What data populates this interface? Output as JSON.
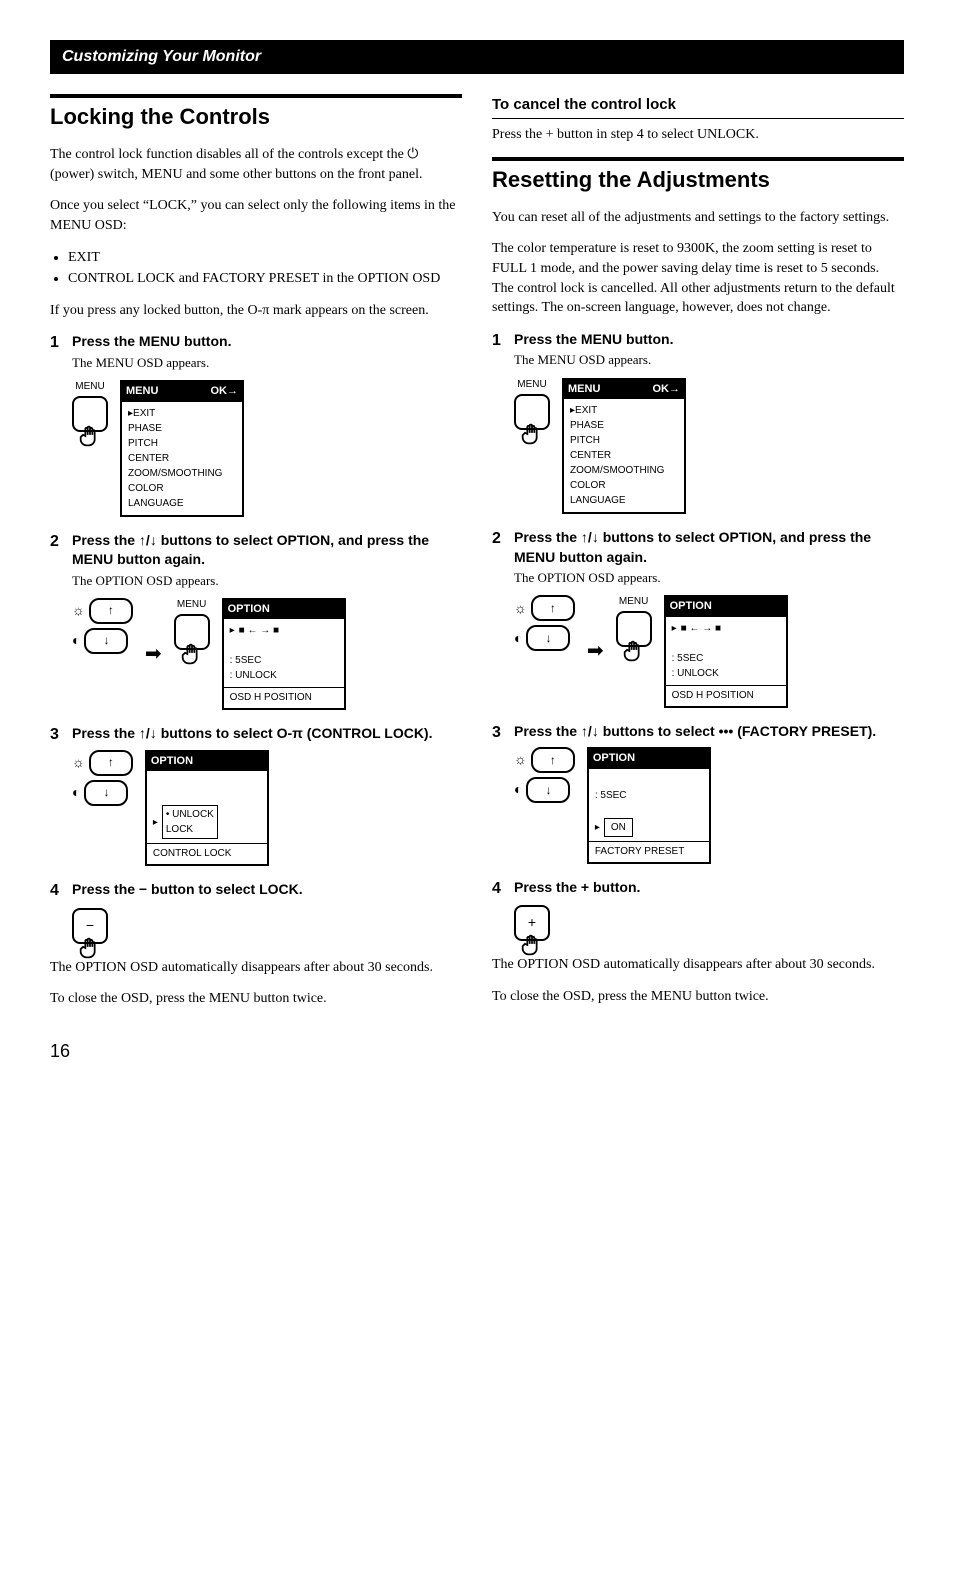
{
  "header": "Customizing Your Monitor",
  "page_number": "16",
  "left": {
    "h1": "Locking the Controls",
    "p1": "The control lock function disables all of the controls except the ⏻ (power) switch, MENU and some other buttons on the front panel.",
    "p2": "Once you select “LOCK,” you can select only the following items in the MENU OSD:",
    "bullets": [
      "EXIT",
      "CONTROL LOCK and FACTORY PRESET in the OPTION OSD"
    ],
    "p3": "If you press any locked button, the O‑π mark appears on the screen.",
    "step1": {
      "num": "1",
      "title": "Press the MENU button.",
      "sub": "The MENU OSD appears.",
      "btn_label": "MENU"
    },
    "menu_osd": {
      "title_left": "MENU",
      "title_right": "OK→",
      "items": [
        "EXIT",
        "PHASE",
        "PITCH",
        "CENTER",
        "ZOOM/SMOOTHING",
        "COLOR",
        "LANGUAGE"
      ]
    },
    "step2": {
      "num": "2",
      "title": "Press the ↑/↓ buttons to select OPTION, and press the MENU button again.",
      "sub": "The OPTION OSD appears.",
      "btn_label": "MENU"
    },
    "option_osd1": {
      "title": "OPTION",
      "lines": [
        "■ ←  → ■",
        "",
        "5SEC",
        "UNLOCK"
      ],
      "footer": "OSD  H  POSITION"
    },
    "step3": {
      "num": "3",
      "title": "Press the ↑/↓ buttons to select O‑π (CONTROL LOCK)."
    },
    "option_osd2": {
      "title": "OPTION",
      "sel": [
        "• UNLOCK",
        "  LOCK"
      ],
      "footer": "CONTROL LOCK"
    },
    "step4": {
      "num": "4",
      "title": "Press the − button to select LOCK."
    },
    "footnote1": "The OPTION OSD automatically disappears after about 30 seconds.",
    "footnote2": "To close the OSD, press the MENU button twice."
  },
  "right": {
    "h2": "To cancel the control lock",
    "p_cancel": "Press the + button in step 4 to select UNLOCK.",
    "h1": "Resetting the Adjustments",
    "p1": "You can reset all of the adjustments and settings to the factory settings.",
    "p2": "The color temperature is reset to 9300K, the zoom setting is reset to FULL 1 mode, and the power saving delay time is reset to 5 seconds. The control lock is cancelled. All other adjustments return to the default settings. The on-screen language, however, does not change.",
    "step1": {
      "num": "1",
      "title": "Press the MENU button.",
      "sub": "The MENU OSD appears.",
      "btn_label": "MENU"
    },
    "menu_osd": {
      "title_left": "MENU",
      "title_right": "OK→",
      "items": [
        "EXIT",
        "PHASE",
        "PITCH",
        "CENTER",
        "ZOOM/SMOOTHING",
        "COLOR",
        "LANGUAGE"
      ]
    },
    "step2": {
      "num": "2",
      "title": "Press the ↑/↓ buttons to select OPTION, and press the MENU button again.",
      "sub": "The OPTION OSD appears.",
      "btn_label": "MENU"
    },
    "option_osd1": {
      "title": "OPTION",
      "lines": [
        "■ ←  → ■",
        "",
        "5SEC",
        "UNLOCK"
      ],
      "footer": "OSD  H  POSITION"
    },
    "step3": {
      "num": "3",
      "title": "Press the ↑/↓ buttons to select ••• (FACTORY PRESET)."
    },
    "option_osd2": {
      "title": "OPTION",
      "line_5sec": "5SEC",
      "sel": "ON",
      "footer": "FACTORY  PRESET"
    },
    "step4": {
      "num": "4",
      "title": "Press the + button."
    },
    "footnote1": "The OPTION OSD automatically disappears after about 30 seconds.",
    "footnote2": "To close the OSD, press the MENU button twice."
  }
}
